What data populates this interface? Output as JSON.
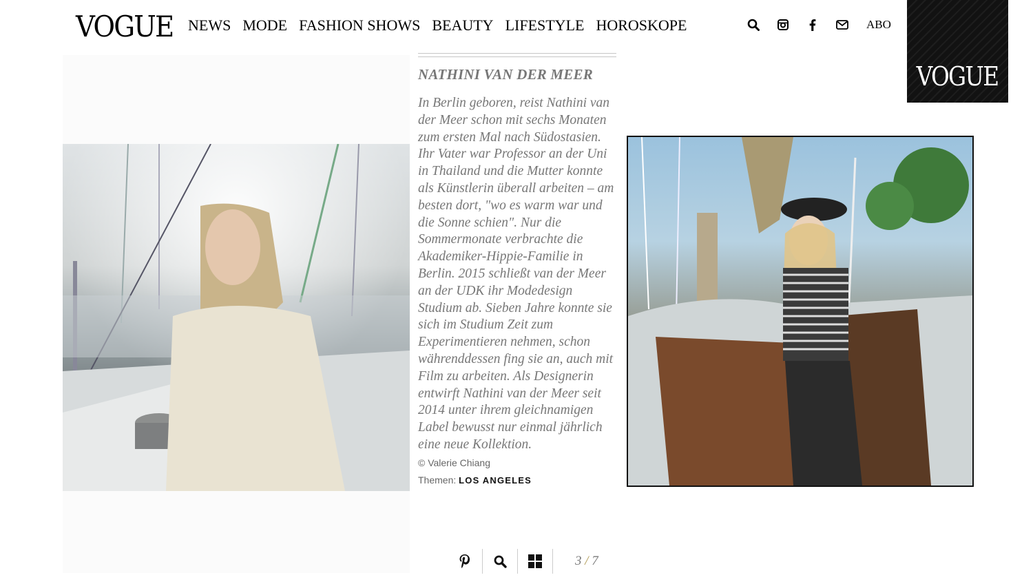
{
  "header": {
    "logo": "VOGUE",
    "nav": [
      "NEWS",
      "MODE",
      "FASHION SHOWS",
      "BEAUTY",
      "LIFESTYLE",
      "HOROSKOPE"
    ],
    "icons": [
      "search-icon",
      "instagram-icon",
      "facebook-icon",
      "mail-icon"
    ],
    "abo_label": "ABO",
    "badge_text": "VOGUE"
  },
  "article": {
    "title": "NATHINI VAN DER MEER",
    "body": "In Berlin geboren, reist Nathini van der Meer schon mit sechs Monaten zum ersten Mal nach Südostasien. Ihr Vater war Professor an der Uni in Thailand und die Mutter konnte als Künstlerin überall arbeiten – am besten dort, \"wo es warm war und die Sonne schien\". Nur die Sommermonate verbrachte die Akademiker-Hippie-Familie in Berlin. 2015 schließt van der Meer an der UDK ihr Modedesign Studium ab. Sieben Jahre konnte sie sich im Studium Zeit zum Experimentieren nehmen, schon währenddessen fing sie an, auch mit Film zu arbeiten. Als Designerin entwirft Nathini van der Meer seit 2014 unter ihrem gleichnamigen Label bewusst nur einmal jährlich eine neue Kollektion.",
    "credit": "© Valerie Chiang",
    "themes_label": "Themen:",
    "theme_link": "LOS ANGELES"
  },
  "toolbar": {
    "icons": [
      "pinterest-icon",
      "zoom-icon",
      "grid-icon"
    ],
    "current": "3",
    "separator": "/",
    "total": "7"
  }
}
